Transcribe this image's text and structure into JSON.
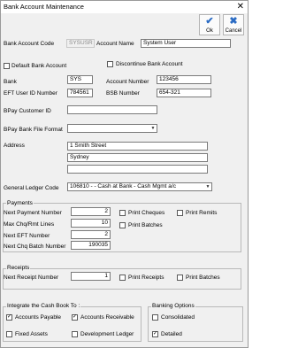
{
  "window": {
    "title": "Bank Account Maintenance",
    "close_glyph": "✕"
  },
  "toolbar": {
    "ok_label": "Ok",
    "cancel_label": "Cancel",
    "ok_icon": "checkmark-icon",
    "cancel_icon": "cross-icon",
    "accent": "#2b6cc4"
  },
  "form": {
    "bank_account_code_label": "Bank Account Code",
    "bank_account_code": "SYSUSR",
    "account_name_label": "Account Name",
    "account_name": "System User",
    "default_bank_account_label": "Default Bank Account",
    "discontinue_label": "Discontinue Bank Account",
    "bank_label": "Bank",
    "bank": "SYS",
    "account_number_label": "Account Number",
    "account_number": "123456",
    "eft_user_id_label": "EFT User ID Number",
    "eft_user_id": "784561",
    "bsb_label": "BSB Number",
    "bsb": "654-321",
    "bpay_customer_id_label": "BPay Customer ID",
    "bpay_customer_id": "",
    "bpay_file_format_label": "BPay Bank File Format",
    "bpay_file_format": "",
    "address_label": "Address",
    "address_lines": [
      "1 Smith Street",
      "Sydney",
      ""
    ],
    "gl_code_label": "General Ledger Code",
    "gl_code": "106810 -  - Cash at Bank - Cash Mgmt a/c"
  },
  "payments": {
    "title": "Payments",
    "next_payment_label": "Next Payment Number",
    "next_payment": "2",
    "max_chq_label": "Max Chq/Rmt Lines",
    "max_chq": "10",
    "next_eft_label": "Next EFT Number",
    "next_eft": "2",
    "next_chq_batch_label": "Next Chq Batch Number",
    "next_chq_batch": "190035",
    "print_cheques_label": "Print Cheques",
    "print_remits_label": "Print Remits",
    "print_batches_label": "Print Batches"
  },
  "receipts": {
    "title": "Receipts",
    "next_receipt_label": "Next Receipt Number",
    "next_receipt": "1",
    "print_receipts_label": "Print Receipts",
    "print_batches_label": "Print Batches"
  },
  "integrate": {
    "title": "Integrate the Cash Book To :",
    "accounts_payable_label": "Accounts Payable",
    "accounts_receivable_label": "Accounts Receivable",
    "fixed_assets_label": "Fixed Assets",
    "development_ledger_label": "Development Ledger",
    "check_glyph": "✓"
  },
  "banking_options": {
    "title": "Banking Options",
    "consolidated_label": "Consolidated",
    "detailed_label": "Detailed",
    "check_glyph": "✓"
  },
  "dropdown_glyph": "▼"
}
